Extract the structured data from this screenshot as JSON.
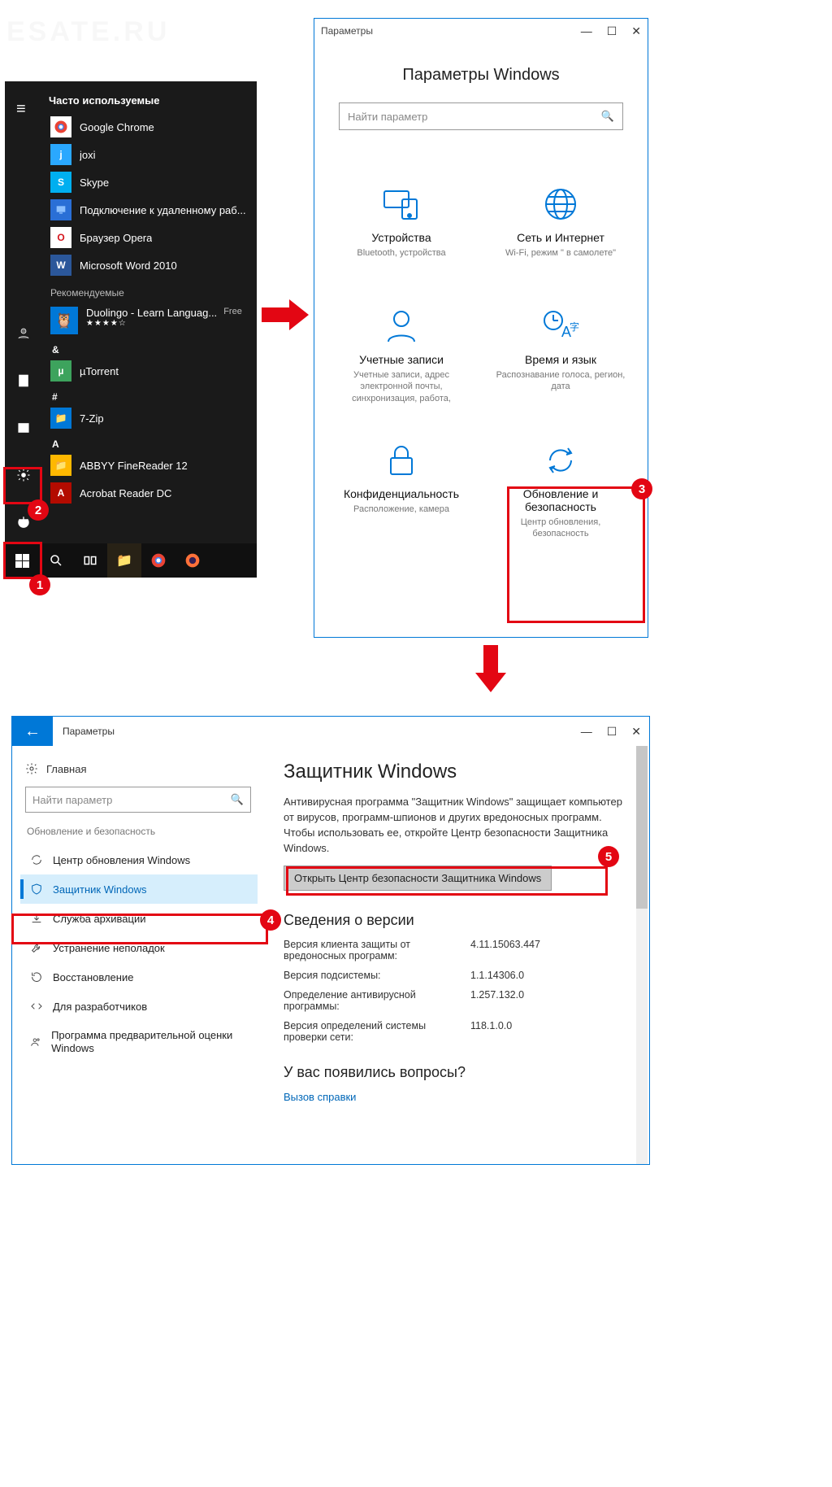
{
  "watermark": "ESATE.RU",
  "startmenu": {
    "frequently_header": "Часто используемые",
    "items": [
      {
        "label": "Google Chrome",
        "color": "#fff",
        "fg": "#000"
      },
      {
        "label": "joxi",
        "color": "#2aa8ff",
        "fg": "#fff"
      },
      {
        "label": "Skype",
        "color": "#00aff0",
        "fg": "#fff",
        "glyph": "S"
      },
      {
        "label": "Подключение к удаленному раб...",
        "color": "#2a6fd6",
        "fg": "#fff"
      },
      {
        "label": "Браузер Opera",
        "color": "#fff",
        "fg": "#d4151c",
        "glyph": "O"
      },
      {
        "label": "Microsoft Word 2010",
        "color": "#2b579a",
        "fg": "#fff",
        "glyph": "W"
      }
    ],
    "recommended_header": "Рекомендуемые",
    "duolingo": {
      "label": "Duolingo - Learn Languag...",
      "free": "Free",
      "stars": "★★★★☆"
    },
    "amp_header": "&",
    "utorrent": "µTorrent",
    "hash_header": "#",
    "seven_zip": "7-Zip",
    "a_header": "A",
    "abbyy": "ABBYY FineReader 12",
    "acrobat": "Acrobat Reader DC"
  },
  "badges": {
    "b1": "1",
    "b2": "2",
    "b3": "3",
    "b4": "4",
    "b5": "5"
  },
  "settings": {
    "window_title": "Параметры",
    "heading": "Параметры Windows",
    "search_placeholder": "Найти параметр",
    "cats": [
      {
        "title": "Устройства",
        "sub": "Bluetooth, устройства"
      },
      {
        "title": "Сеть и Интернет",
        "sub": "Wi-Fi, режим \" в самолете\""
      },
      {
        "title": "Учетные записи",
        "sub": "Учетные записи, адрес электронной почты, синхронизация, работа,"
      },
      {
        "title": "Время и язык",
        "sub": "Распознавание голоса, регион, дата"
      },
      {
        "title": "Конфиденциальность",
        "sub": "Расположение, камера"
      },
      {
        "title": "Обновление и безопасность",
        "sub": "Центр обновления, безопасность"
      }
    ]
  },
  "detail": {
    "window_title": "Параметры",
    "home": "Главная",
    "search_placeholder": "Найти параметр",
    "section_header": "Обновление и безопасность",
    "nav": [
      "Центр обновления Windows",
      "Защитник Windows",
      "Служба архивации",
      "Устранение неполадок",
      "Восстановление",
      "Для разработчиков",
      "Программа предварительной оценки Windows"
    ],
    "page_title": "Защитник Windows",
    "description": "Антивирусная программа \"Защитник Windows\" защищает компьютер от вирусов, программ-шпионов и других вредоносных программ. Чтобы использовать ее, откройте Центр безопасности Защитника Windows.",
    "open_button": "Открыть Центр безопасности Защитника Windows",
    "version_header": "Сведения о версии",
    "rows": [
      {
        "k": "Версия клиента защиты от вредоносных программ:",
        "v": "4.11.15063.447"
      },
      {
        "k": "Версия подсистемы:",
        "v": "1.1.14306.0"
      },
      {
        "k": "Определение антивирусной программы:",
        "v": "1.257.132.0"
      },
      {
        "k": "Версия определений системы проверки сети:",
        "v": "118.1.0.0"
      }
    ],
    "help_header": "У вас появились вопросы?",
    "help_link": "Вызов справки"
  }
}
